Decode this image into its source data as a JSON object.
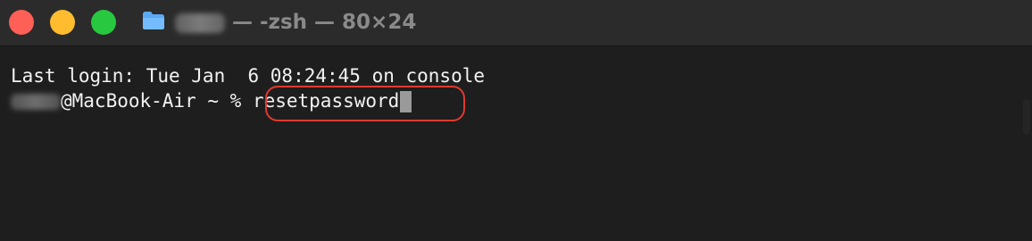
{
  "window": {
    "title_separator_1": "—",
    "title_shell": "-zsh",
    "title_separator_2": "—",
    "title_size": "80×24",
    "accent_colors": {
      "close": "#fe5f57",
      "minimize": "#febc2e",
      "maximize": "#28c840",
      "highlight": "#e1392f"
    },
    "icons": {
      "folder": "folder-icon"
    }
  },
  "terminal": {
    "last_login": "Last login: Tue Jan  6 08:24:45 on console",
    "prompt_host": "@MacBook-Air ~ % ",
    "command": "resetpassword"
  }
}
